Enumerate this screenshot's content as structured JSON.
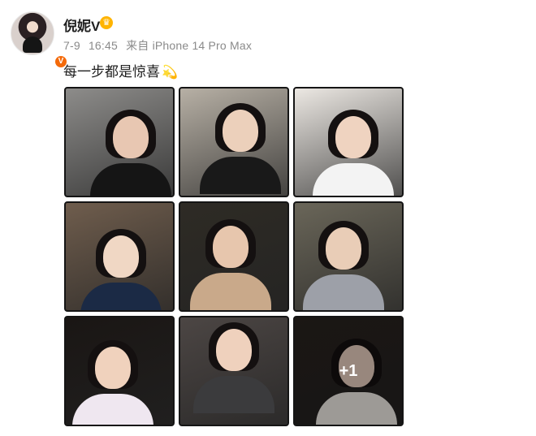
{
  "post": {
    "username": "倪妮V",
    "date": "7-9",
    "time": "16:45",
    "source": "来自 iPhone 14 Pro Max",
    "text": "每一步都是惊喜",
    "text_emoji": "💫",
    "avatar_badge": "V",
    "member_badge": "♛"
  },
  "gallery": {
    "more_count_label": "+1",
    "photos": [
      {
        "bg": "#8d8c8a",
        "tone": "#e8c7b2",
        "outfit": "#151515"
      },
      {
        "bg": "#b7b0a5",
        "tone": "#ecd0bb",
        "outfit": "#191919"
      },
      {
        "bg": "#ece8e3",
        "tone": "#efd3c0",
        "outfit": "#f3f3f3"
      },
      {
        "bg": "#6f5d4d",
        "tone": "#f0d7c4",
        "outfit": "#1b2a45"
      },
      {
        "bg": "#2e2b25",
        "tone": "#e7c6ad",
        "outfit": "#c9a98a"
      },
      {
        "bg": "#6a6659",
        "tone": "#e9cdb7",
        "outfit": "#9da0a8"
      },
      {
        "bg": "#1a1614",
        "tone": "#f0d2bd",
        "outfit": "#efe7f0"
      },
      {
        "bg": "#4c4644",
        "tone": "#efd1bd",
        "outfit": "#3b3b3d"
      },
      {
        "bg": "#2a2420",
        "tone": "#ead0c0",
        "outfit": "#f2ede7"
      }
    ]
  }
}
